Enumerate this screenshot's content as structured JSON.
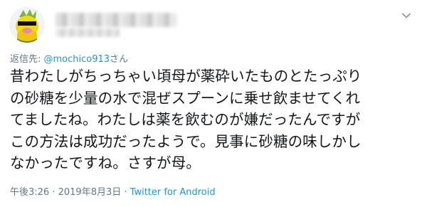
{
  "reply": {
    "prefix": "返信先: ",
    "mention": "@mochico913",
    "suffix": "さん"
  },
  "tweet": {
    "lines": [
      "昔わたしがちっちゃい頃母が薬砕いたものとたっぷり",
      "の砂糖を少量の水で混ぜスプーンに乗せ飲ませてくれ",
      "てましたね。わたしは薬を飲むのが嫌だったんですが",
      "この方法は成功だったようで。見事に砂糖の味しかし",
      "なかったですね。さすが母。"
    ]
  },
  "meta": {
    "time": "午後3:26",
    "separator": " · ",
    "date": "2019年8月3日",
    "separator2": " · ",
    "source": "Twitter for Android"
  },
  "icons": {
    "avatar": "avatar-yellow-character",
    "menu": "chevron-down-icon"
  },
  "colors": {
    "text": "#14171a",
    "muted": "#657786",
    "link": "#1b95e0"
  }
}
